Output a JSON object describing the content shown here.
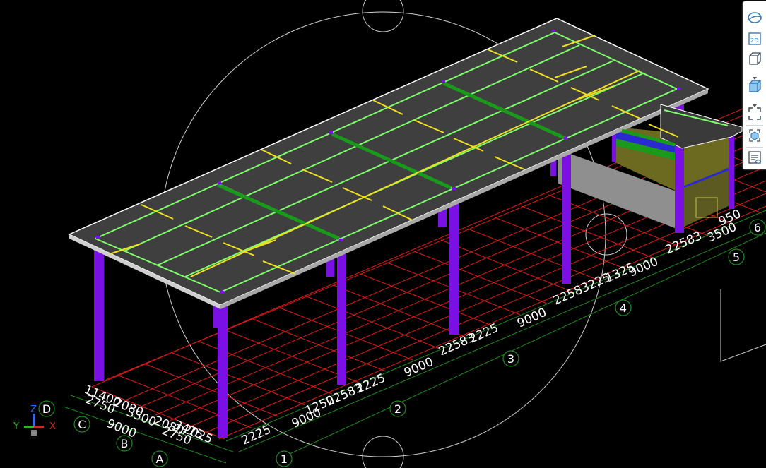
{
  "viewport": {
    "grid_bubbles": {
      "axis_1": "1",
      "axis_2": "2",
      "axis_3": "3",
      "axis_4": "4",
      "axis_5": "5",
      "axis_6": "6",
      "axis_A": "A",
      "axis_B": "B",
      "axis_C": "C",
      "axis_D": "D"
    },
    "dimensions": {
      "d_2225_a": "2225",
      "d_9000_a": "9000",
      "d_1250": "1250",
      "d_22583": "22583",
      "d_2225_b": "2225",
      "d_9000_b": "9000",
      "d_22583_b": "22583",
      "d_2225_c": "2225",
      "d_9000_c": "9000",
      "d_2258_mix": "22583225",
      "d_1325": "1325",
      "d_9000_d": "9000",
      "d_22583_c": "22583",
      "d_3500_r": "3500",
      "d_950": "950",
      "left_1": "11400",
      "left_2": "2750",
      "left_3": "2080",
      "left_4": "3500",
      "left_5": "9000",
      "left_6": "2080",
      "left_7": "2750",
      "left_8": "3475",
      "left_9": "2025"
    },
    "axis_gizmo": {
      "z": "Z",
      "y": "Y",
      "x": "X"
    }
  },
  "toolbar": {
    "items": [
      "orbit-icon",
      "2d-view-icon",
      "3d-box-icon",
      "shaded-cube-icon",
      "fit-extents-icon",
      "isolate-object-icon",
      "layer-list-icon"
    ],
    "label_2d": "2D"
  },
  "colors": {
    "background": "#000000",
    "grid_red": "#e01a1a",
    "column_purple": "#7a10e6",
    "slab_gray": "#3f3f3f",
    "beam_green_light": "#7dff6a",
    "beam_green_dark": "#1a9a1a",
    "beam_yellow": "#f0e020",
    "dimension_green": "#1e8a1e"
  }
}
